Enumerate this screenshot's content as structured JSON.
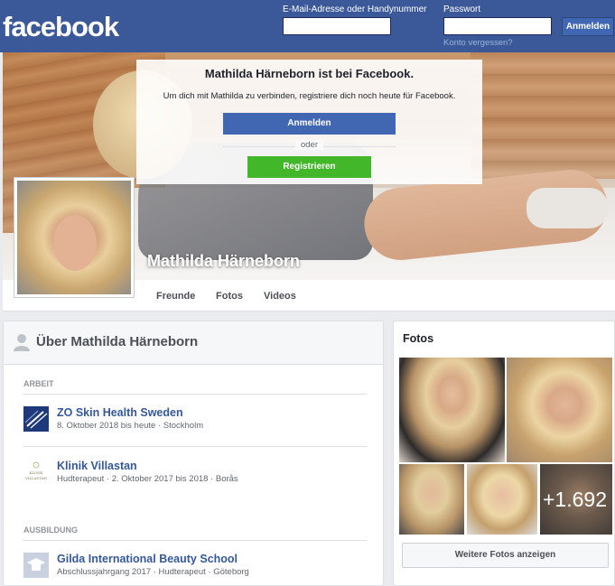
{
  "header": {
    "logo": "facebook",
    "email_label": "E-Mail-Adresse oder Handynummer",
    "password_label": "Passwort",
    "email_value": "",
    "password_value": "",
    "login_button": "Anmelden",
    "forgot_link": "Konto vergessen?"
  },
  "overlay": {
    "title": "Mathilda Härneborn ist bei Facebook.",
    "text": "Um dich mit Mathilda zu verbinden, registriere dich noch heute für Facebook.",
    "login_button": "Anmelden",
    "or": "oder",
    "register_button": "Registrieren"
  },
  "profile": {
    "name": "Mathilda Härneborn"
  },
  "nav": {
    "items": [
      "Freunde",
      "Fotos",
      "Videos"
    ]
  },
  "about": {
    "title": "Über Mathilda Härneborn",
    "work_heading": "ARBEIT",
    "work": [
      {
        "name": "ZO Skin Health Sweden",
        "detail": "8. Oktober 2018 bis heute · Stockholm",
        "logo": "zo-skin-logo"
      },
      {
        "name": "Klinik Villastan",
        "detail": "Hudterapeut · 2. Oktober 2017 bis 2018 · Borås",
        "logo": "klinik-villastan-logo",
        "logo_text": "KLINIK\nVILLASTAN"
      }
    ],
    "education_heading": "AUSBILDUNG",
    "education": [
      {
        "name": "Gilda International Beauty School",
        "detail": "Abschlussjahrgang 2017 · Hudterapeut · Göteborg",
        "logo": "school-logo"
      }
    ]
  },
  "photos": {
    "title": "Fotos",
    "more_count": "+1.692",
    "more_button": "Weitere Fotos anzeigen"
  },
  "colors": {
    "brand_blue": "#3b5998",
    "button_blue": "#4267b2",
    "green": "#42b72a",
    "link_blue": "#365899"
  }
}
